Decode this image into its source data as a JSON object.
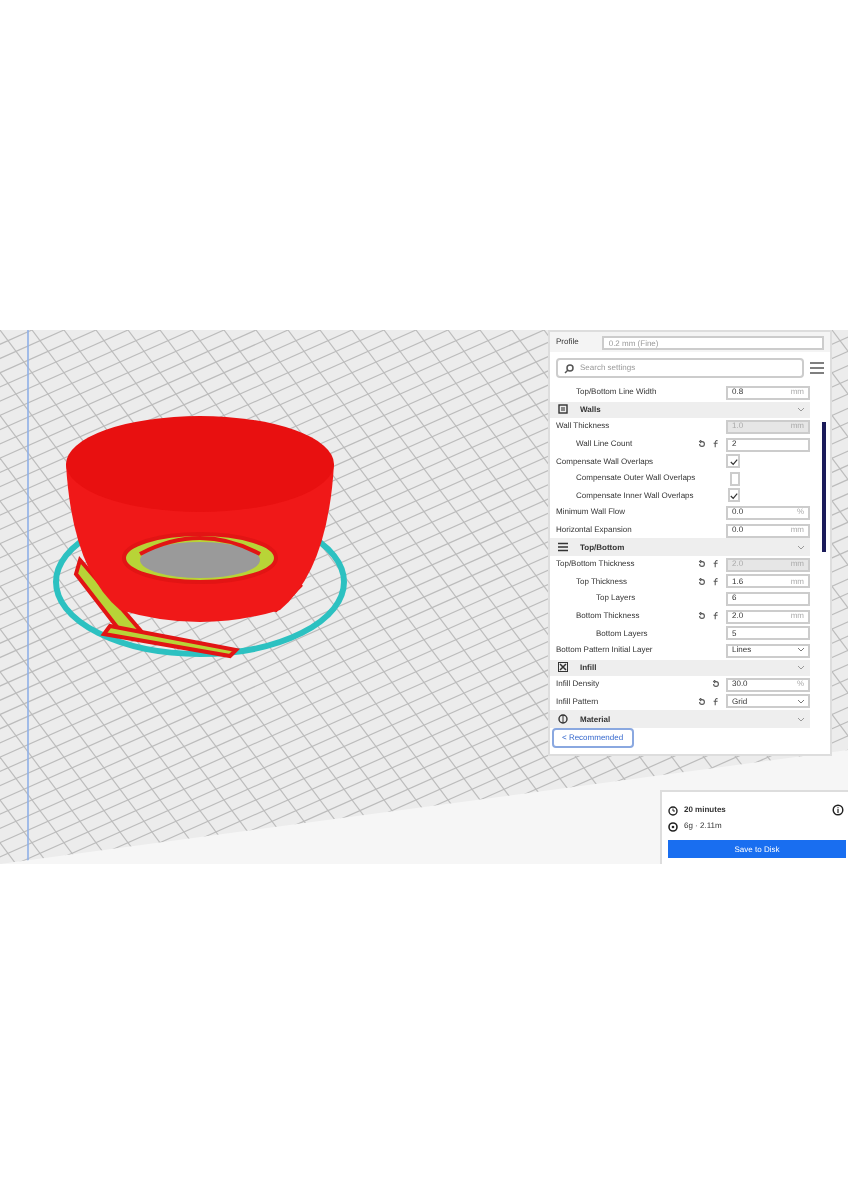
{
  "profile": {
    "label": "Profile",
    "value": "0.2 mm (Fine)"
  },
  "search": {
    "placeholder": "Search settings"
  },
  "scrolled_rows": [
    {
      "kind": "number",
      "label": "Top/Bottom Line Width",
      "value": "0.8",
      "unit": "mm",
      "disabled": false
    }
  ],
  "sections": [
    {
      "title": "Walls",
      "settings": [
        {
          "kind": "number",
          "label": "Wall Thickness",
          "value": "1.0",
          "unit": "mm",
          "disabled": true,
          "children": [
            {
              "kind": "number",
              "label": "Wall Line Count",
              "value": "2",
              "disabled": false,
              "reset": true,
              "formula": true
            }
          ]
        },
        {
          "kind": "checkbox",
          "label": "Compensate Wall Overlaps",
          "checked": true,
          "children": [
            {
              "kind": "checkbox",
              "label": "Compensate Outer Wall Overlaps",
              "checked": false
            },
            {
              "kind": "checkbox",
              "label": "Compensate Inner Wall Overlaps",
              "checked": true
            }
          ]
        },
        {
          "kind": "number",
          "label": "Minimum Wall Flow",
          "value": "0.0",
          "unit": "%",
          "disabled": false
        },
        {
          "kind": "number",
          "label": "Horizontal Expansion",
          "value": "0.0",
          "unit": "mm",
          "disabled": false
        }
      ]
    },
    {
      "title": "Top/Bottom",
      "settings": [
        {
          "kind": "number",
          "label": "Top/Bottom Thickness",
          "value": "2.0",
          "unit": "mm",
          "disabled": true,
          "reset": true,
          "formula": true,
          "children": [
            {
              "kind": "number",
              "label": "Top Thickness",
              "value": "1.6",
              "unit": "mm",
              "disabled": false,
              "reset": true,
              "formula": true,
              "children": [
                {
                  "kind": "number",
                  "label": "Top Layers",
                  "value": "6",
                  "disabled": false
                }
              ]
            },
            {
              "kind": "number",
              "label": "Bottom Thickness",
              "value": "2.0",
              "unit": "mm",
              "disabled": false,
              "reset": true,
              "formula": true,
              "children": [
                {
                  "kind": "number",
                  "label": "Bottom Layers",
                  "value": "5",
                  "disabled": false
                }
              ]
            }
          ]
        },
        {
          "kind": "dropdown",
          "label": "Bottom Pattern Initial Layer",
          "value": "Lines"
        }
      ]
    },
    {
      "title": "Infill",
      "settings": [
        {
          "kind": "number",
          "label": "Infill Density",
          "value": "30.0",
          "unit": "%",
          "disabled": false,
          "reset": true
        },
        {
          "kind": "dropdown",
          "label": "Infill Pattern",
          "value": "Grid",
          "reset": true,
          "formula": true
        }
      ]
    },
    {
      "title": "Material"
    }
  ],
  "recommended_button": "< Recommended",
  "print_info": {
    "time": "20 minutes",
    "material": "6g · 2.11m",
    "save_button": "Save to Disk"
  }
}
